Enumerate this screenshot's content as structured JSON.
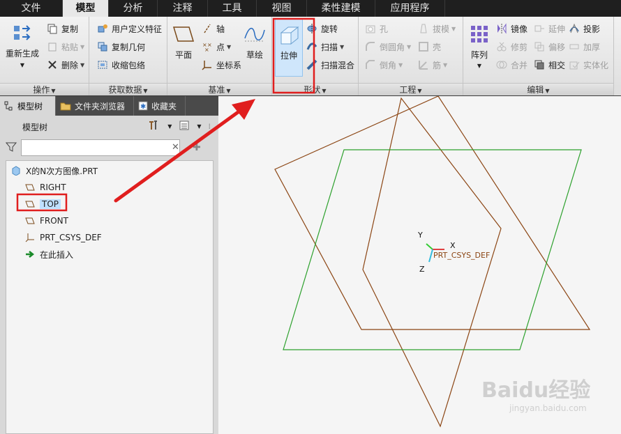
{
  "tabs": [
    "文件",
    "模型",
    "分析",
    "注释",
    "工具",
    "视图",
    "柔性建模",
    "应用程序"
  ],
  "ribbon": {
    "ops": {
      "regen": "重新生成",
      "copy": "复制",
      "paste": "粘贴",
      "delete": "删除",
      "label": "操作"
    },
    "getdata": {
      "udf": "用户定义特征",
      "copygeom": "复制几何",
      "shrinkwrap": "收缩包络",
      "label": "获取数据"
    },
    "datum": {
      "plane": "平面",
      "axis": "轴",
      "point": "点",
      "csys": "坐标系",
      "sketch": "草绘",
      "label": "基准"
    },
    "shapes": {
      "extrude": "拉伸",
      "revolve": "旋转",
      "sweep": "扫描",
      "sweptblend": "扫描混合",
      "label": "形状"
    },
    "engineering": {
      "hole": "孔",
      "round": "倒圆角",
      "chamfer": "倒角",
      "draft": "拔模",
      "shell": "壳",
      "rib": "筋",
      "label": "工程"
    },
    "editing": {
      "pattern": "阵列",
      "mirror": "镜像",
      "extend": "延伸",
      "project": "投影",
      "trim": "修剪",
      "offset": "偏移",
      "thicken": "加厚",
      "merge": "合并",
      "intersect": "相交",
      "solidify": "实体化",
      "label": "编辑"
    }
  },
  "panel": {
    "tabs": [
      "模型树",
      "文件夹浏览器",
      "收藏夹"
    ],
    "tree_title": "模型树",
    "search_placeholder": "",
    "tree": {
      "root": "X的N次方图像.PRT",
      "right": "RIGHT",
      "top": "TOP",
      "front": "FRONT",
      "csys": "PRT_CSYS_DEF",
      "insert": "在此插入"
    }
  },
  "viewport": {
    "axis_x": "X",
    "axis_y": "Y",
    "axis_z": "Z",
    "csys_label": "PRT_CSYS_DEF"
  },
  "watermark": {
    "brand": "Baidu经验",
    "url": "jingyan.baidu.com"
  },
  "colors": {
    "accent_red": "#e01e1e",
    "plane_brown": "#8b4513",
    "plane_green": "#2ca02c",
    "selection": "#bfe0ff"
  }
}
